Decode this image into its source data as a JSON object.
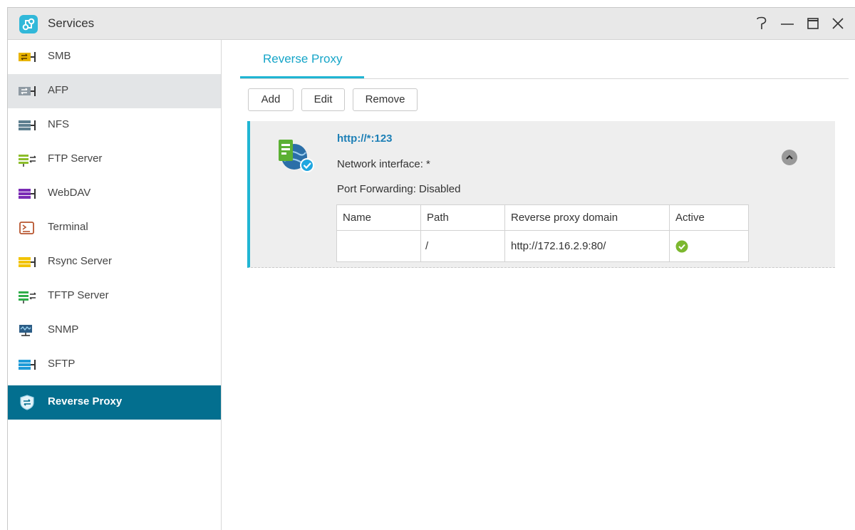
{
  "window": {
    "title": "Services"
  },
  "sidebar": {
    "items": [
      {
        "label": "SMB",
        "icon": "smb-icon",
        "state": "normal"
      },
      {
        "label": "AFP",
        "icon": "afp-icon",
        "state": "hover"
      },
      {
        "label": "NFS",
        "icon": "nfs-icon",
        "state": "normal"
      },
      {
        "label": "FTP Server",
        "icon": "ftp-icon",
        "state": "normal"
      },
      {
        "label": "WebDAV",
        "icon": "webdav-icon",
        "state": "normal"
      },
      {
        "label": "Terminal",
        "icon": "terminal-icon",
        "state": "normal"
      },
      {
        "label": "Rsync Server",
        "icon": "rsync-icon",
        "state": "normal"
      },
      {
        "label": "TFTP Server",
        "icon": "tftp-icon",
        "state": "normal"
      },
      {
        "label": "SNMP",
        "icon": "snmp-icon",
        "state": "normal"
      },
      {
        "label": "SFTP",
        "icon": "sftp-icon",
        "state": "normal"
      },
      {
        "label": "Reverse Proxy",
        "icon": "reverse-proxy-icon",
        "state": "active"
      }
    ]
  },
  "main": {
    "tab": "Reverse Proxy",
    "toolbar": {
      "add": "Add",
      "edit": "Edit",
      "remove": "Remove"
    },
    "rule": {
      "title": "http://*:123",
      "network_interface": "Network interface: *",
      "port_forwarding": "Port Forwarding: Disabled",
      "table": {
        "headers": [
          "Name",
          "Path",
          "Reverse proxy domain",
          "Active"
        ],
        "rows": [
          {
            "name": "",
            "path": "/",
            "domain": "http://172.16.2.9:80/",
            "active": true
          }
        ]
      }
    }
  },
  "colors": {
    "accent": "#1fb5d3",
    "active_sidebar": "#036f8f",
    "title_link": "#1c7fb6",
    "active_check": "#7cb82f"
  }
}
